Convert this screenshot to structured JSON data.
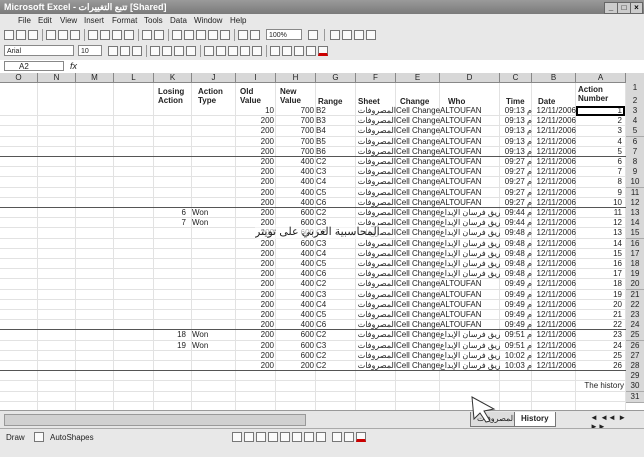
{
  "window": {
    "title": "Microsoft Excel - تتبع التغييرات [Shared]"
  },
  "menus": [
    "File",
    "Edit",
    "View",
    "Insert",
    "Format",
    "Tools",
    "Data",
    "Window",
    "Help"
  ],
  "toolbar": {
    "font_name": "Arial",
    "font_size": "10",
    "zoom": "100%"
  },
  "formula_bar": {
    "cell_ref": "A2",
    "fx": "fx"
  },
  "columns": [
    "O",
    "N",
    "M",
    "L",
    "K",
    "J",
    "I",
    "H",
    "G",
    "F",
    "E",
    "D",
    "C",
    "B",
    "A"
  ],
  "headers": {
    "action_number": "Action\nNumber",
    "date": "Date",
    "time": "Time",
    "who": "Who",
    "change": "Change",
    "sheet": "Sheet",
    "range": "Range",
    "new_value": "New\nValue",
    "old_value": "Old\nValue",
    "action_type": "Action\nType",
    "losing_action": "Losing\nAction"
  },
  "overlay_text": "المحاسبية العربي على تويتر",
  "rows": [
    {
      "n": "3",
      "a": "1",
      "date": "12/11/2006",
      "time": "09:13 م",
      "who": "ALTOUFAN",
      "change": "Cell Change",
      "sheet": "المصروفات",
      "range": "B2",
      "new": "700",
      "old": "10",
      "type": "",
      "losing": ""
    },
    {
      "n": "4",
      "a": "2",
      "date": "12/11/2006",
      "time": "09:13 م",
      "who": "ALTOUFAN",
      "change": "Cell Change",
      "sheet": "المصروفات",
      "range": "B3",
      "new": "700",
      "old": "200",
      "type": "",
      "losing": ""
    },
    {
      "n": "5",
      "a": "3",
      "date": "12/11/2006",
      "time": "09:13 م",
      "who": "ALTOUFAN",
      "change": "Cell Change",
      "sheet": "المصروفات",
      "range": "B4",
      "new": "700",
      "old": "200",
      "type": "",
      "losing": ""
    },
    {
      "n": "6",
      "a": "4",
      "date": "12/11/2006",
      "time": "09:13 م",
      "who": "ALTOUFAN",
      "change": "Cell Change",
      "sheet": "المصروفات",
      "range": "B5",
      "new": "700",
      "old": "200",
      "type": "",
      "losing": ""
    },
    {
      "n": "7",
      "a": "5",
      "date": "12/11/2006",
      "time": "09:13 م",
      "who": "ALTOUFAN",
      "change": "Cell Change",
      "sheet": "المصروفات",
      "range": "B6",
      "new": "700",
      "old": "200",
      "type": "",
      "losing": ""
    },
    {
      "n": "8",
      "a": "6",
      "date": "12/11/2006",
      "time": "09:27 م",
      "who": "ALTOUFAN",
      "change": "Cell Change",
      "sheet": "المصروفات",
      "range": "C2",
      "new": "400",
      "old": "200",
      "type": "",
      "losing": ""
    },
    {
      "n": "9",
      "a": "7",
      "date": "12/11/2006",
      "time": "09:27 م",
      "who": "ALTOUFAN",
      "change": "Cell Change",
      "sheet": "المصروفات",
      "range": "C3",
      "new": "400",
      "old": "200",
      "type": "",
      "losing": ""
    },
    {
      "n": "10",
      "a": "8",
      "date": "12/11/2006",
      "time": "09:27 م",
      "who": "ALTOUFAN",
      "change": "Cell Change",
      "sheet": "المصروفات",
      "range": "C4",
      "new": "400",
      "old": "200",
      "type": "",
      "losing": ""
    },
    {
      "n": "11",
      "a": "9",
      "date": "12/11/2006",
      "time": "09:27 م",
      "who": "ALTOUFAN",
      "change": "Cell Change",
      "sheet": "المصروفات",
      "range": "C5",
      "new": "400",
      "old": "200",
      "type": "",
      "losing": ""
    },
    {
      "n": "12",
      "a": "10",
      "date": "12/11/2006",
      "time": "09:27 م",
      "who": "ALTOUFAN",
      "change": "Cell Change",
      "sheet": "المصروفات",
      "range": "C6",
      "new": "400",
      "old": "200",
      "type": "",
      "losing": ""
    },
    {
      "n": "13",
      "a": "11",
      "date": "12/11/2006",
      "time": "09:44 م",
      "who": "فريق فرسان الإبداع",
      "change": "Cell Change",
      "sheet": "المصروفات",
      "range": "C2",
      "new": "600",
      "old": "200",
      "type": "Won",
      "losing": "6"
    },
    {
      "n": "14",
      "a": "12",
      "date": "12/11/2006",
      "time": "09:44 م",
      "who": "فريق فرسان الإبداع",
      "change": "Cell Change",
      "sheet": "المصروفات",
      "range": "C3",
      "new": "600",
      "old": "200",
      "type": "Won",
      "losing": "7"
    },
    {
      "n": "15",
      "a": "13",
      "date": "12/11/2006",
      "time": "09:48 م",
      "who": "فريق فرسان الإبداع",
      "change": "Cell Change",
      "sheet": "المصروفات",
      "range": "C2",
      "new": "600",
      "old": "200",
      "type": "",
      "losing": ""
    },
    {
      "n": "16",
      "a": "14",
      "date": "12/11/2006",
      "time": "09:48 م",
      "who": "فريق فرسان الإبداع",
      "change": "Cell Change",
      "sheet": "المصروفات",
      "range": "C3",
      "new": "600",
      "old": "200",
      "type": "",
      "losing": ""
    },
    {
      "n": "17",
      "a": "15",
      "date": "12/11/2006",
      "time": "09:48 م",
      "who": "فريق فرسان الإبداع",
      "change": "Cell Change",
      "sheet": "المصروفات",
      "range": "C4",
      "new": "400",
      "old": "200",
      "type": "",
      "losing": ""
    },
    {
      "n": "18",
      "a": "16",
      "date": "12/11/2006",
      "time": "09:48 م",
      "who": "فريق فرسان الإبداع",
      "change": "Cell Change",
      "sheet": "المصروفات",
      "range": "C5",
      "new": "400",
      "old": "200",
      "type": "",
      "losing": ""
    },
    {
      "n": "19",
      "a": "17",
      "date": "12/11/2006",
      "time": "09:48 م",
      "who": "فريق فرسان الإبداع",
      "change": "Cell Change",
      "sheet": "المصروفات",
      "range": "C6",
      "new": "400",
      "old": "200",
      "type": "",
      "losing": ""
    },
    {
      "n": "20",
      "a": "18",
      "date": "12/11/2006",
      "time": "09:49 م",
      "who": "ALTOUFAN",
      "change": "Cell Change",
      "sheet": "المصروفات",
      "range": "C2",
      "new": "400",
      "old": "200",
      "type": "",
      "losing": ""
    },
    {
      "n": "21",
      "a": "19",
      "date": "12/11/2006",
      "time": "09:49 م",
      "who": "ALTOUFAN",
      "change": "Cell Change",
      "sheet": "المصروفات",
      "range": "C3",
      "new": "400",
      "old": "200",
      "type": "",
      "losing": ""
    },
    {
      "n": "22",
      "a": "20",
      "date": "12/11/2006",
      "time": "09:49 م",
      "who": "ALTOUFAN",
      "change": "Cell Change",
      "sheet": "المصروفات",
      "range": "C4",
      "new": "400",
      "old": "200",
      "type": "",
      "losing": ""
    },
    {
      "n": "23",
      "a": "21",
      "date": "12/11/2006",
      "time": "09:49 م",
      "who": "ALTOUFAN",
      "change": "Cell Change",
      "sheet": "المصروفات",
      "range": "C5",
      "new": "400",
      "old": "200",
      "type": "",
      "losing": ""
    },
    {
      "n": "24",
      "a": "22",
      "date": "12/11/2006",
      "time": "09:49 م",
      "who": "ALTOUFAN",
      "change": "Cell Change",
      "sheet": "المصروفات",
      "range": "C6",
      "new": "400",
      "old": "200",
      "type": "",
      "losing": ""
    },
    {
      "n": "25",
      "a": "23",
      "date": "12/11/2006",
      "time": "09:51 م",
      "who": "فريق فرسان الإبداع",
      "change": "Cell Change",
      "sheet": "المصروفات",
      "range": "C2",
      "new": "600",
      "old": "200",
      "type": "Won",
      "losing": "18"
    },
    {
      "n": "26",
      "a": "24",
      "date": "12/11/2006",
      "time": "09:51 م",
      "who": "فريق فرسان الإبداع",
      "change": "Cell Change",
      "sheet": "المصروفات",
      "range": "C3",
      "new": "600",
      "old": "200",
      "type": "Won",
      "losing": "19"
    },
    {
      "n": "27",
      "a": "25",
      "date": "12/11/2006",
      "time": "10:02 م",
      "who": "فريق فرسان الإبداع",
      "change": "Cell Change",
      "sheet": "المصروفات",
      "range": "C2",
      "new": "600",
      "old": "200",
      "type": "",
      "losing": ""
    },
    {
      "n": "28",
      "a": "26",
      "date": "12/11/2006",
      "time": "10:03 م",
      "who": "فريق فرسان الإبداع",
      "change": "Cell Change",
      "sheet": "المصروفات",
      "range": "C2",
      "new": "200",
      "old": "200",
      "type": "",
      "losing": ""
    },
    {
      "n": "29",
      "a": "",
      "date": "",
      "time": "",
      "who": "",
      "change": "",
      "sheet": "",
      "range": "",
      "new": "",
      "old": "",
      "type": "",
      "losing": ""
    },
    {
      "n": "30",
      "a": "The history",
      "date": "",
      "time": "",
      "who": "",
      "change": "",
      "sheet": "",
      "range": "",
      "new": "",
      "old": "",
      "type": "",
      "losing": ""
    },
    {
      "n": "31",
      "a": "",
      "date": "",
      "time": "",
      "who": "",
      "change": "",
      "sheet": "",
      "range": "",
      "new": "",
      "old": "",
      "type": "",
      "losing": ""
    }
  ],
  "sheet_tabs": {
    "history": "History",
    "expenses": "المصروفات"
  },
  "status": {
    "draw": "Draw",
    "autoshapes": "AutoShapes"
  }
}
